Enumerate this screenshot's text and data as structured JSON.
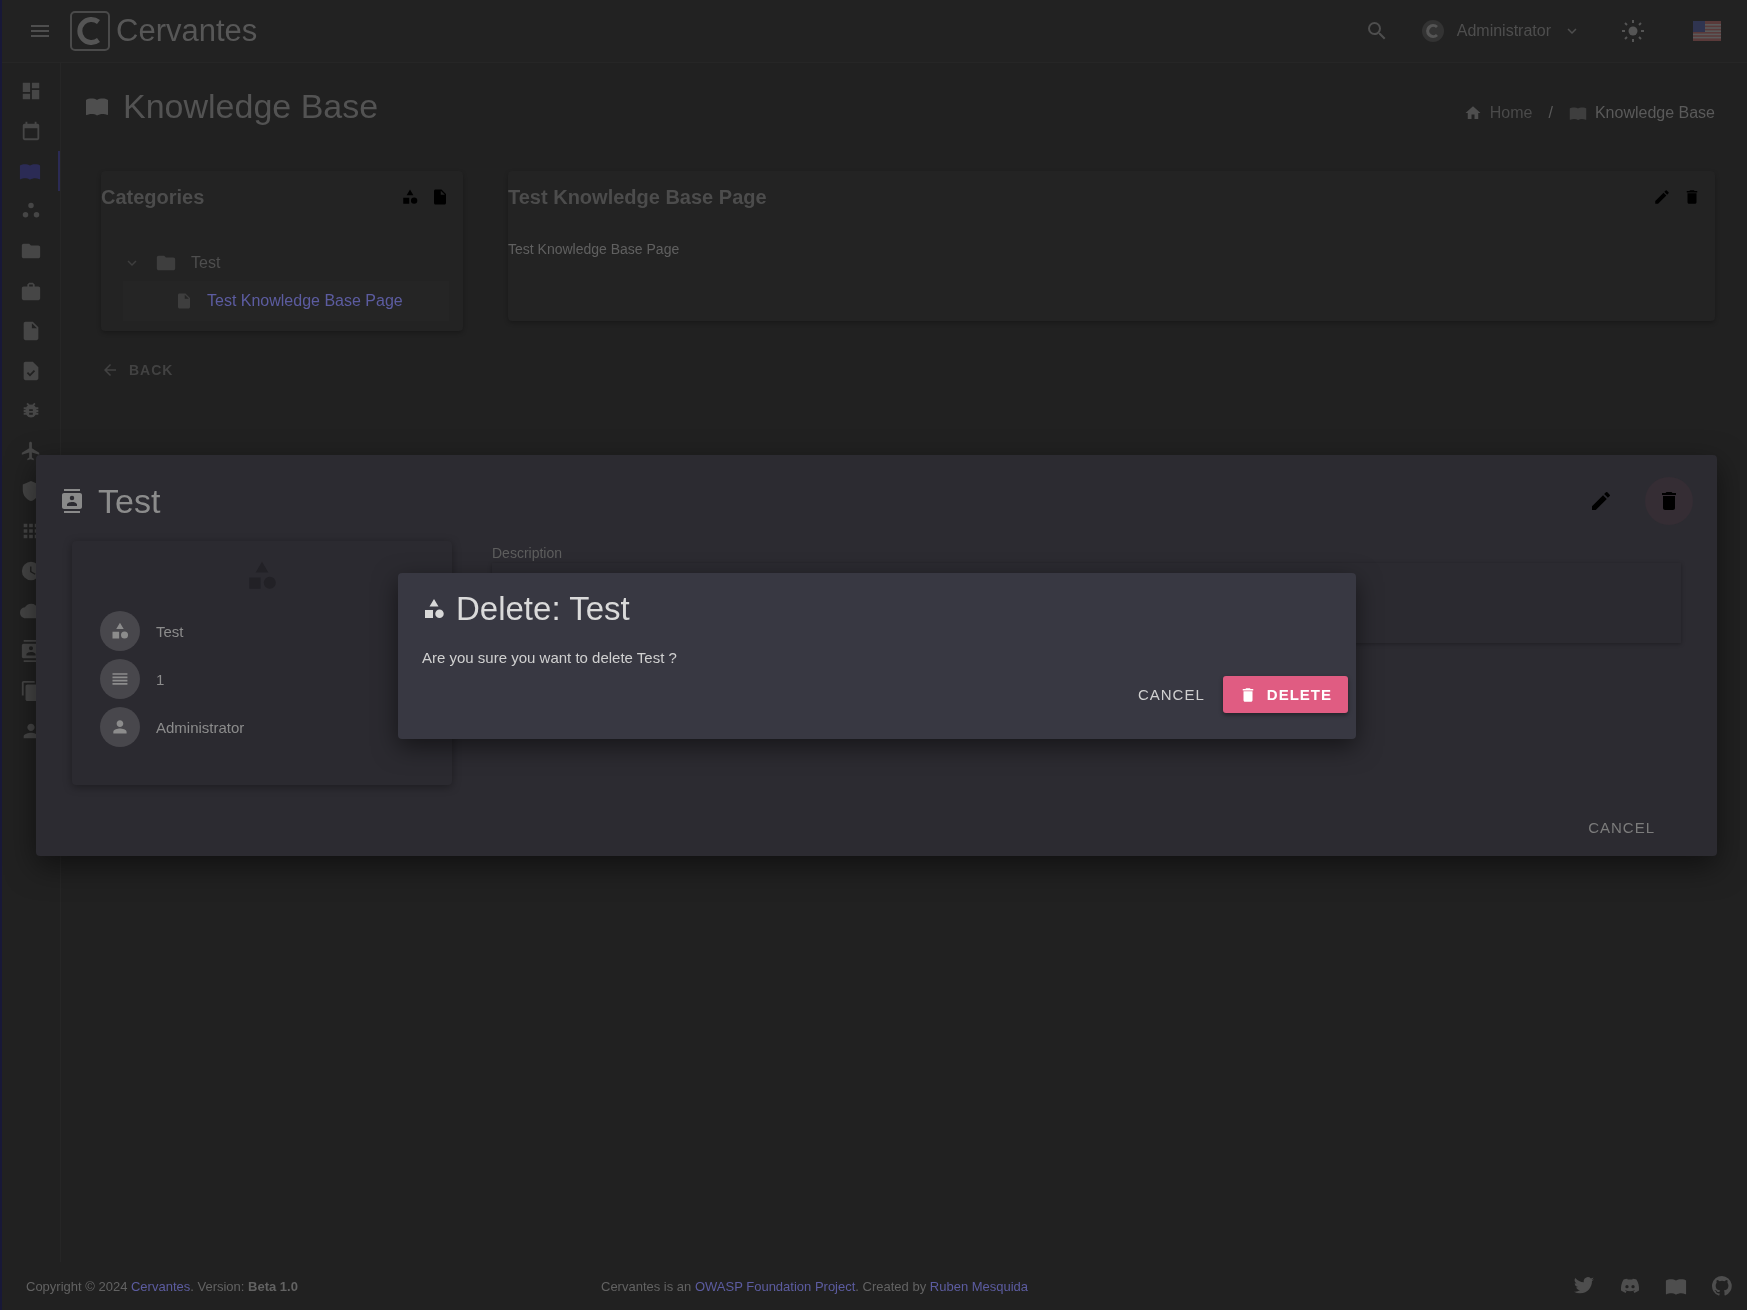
{
  "app": {
    "name": "Cervantes"
  },
  "top_bar": {
    "user": "Administrator"
  },
  "sidebar": {
    "items": [
      {
        "kind": "dashboard",
        "selected": false
      },
      {
        "kind": "calendar",
        "selected": false
      },
      {
        "kind": "book",
        "selected": true
      },
      {
        "kind": "clients",
        "selected": false
      },
      {
        "kind": "folder",
        "selected": false
      },
      {
        "kind": "briefcase",
        "selected": false
      },
      {
        "kind": "document",
        "selected": false
      },
      {
        "kind": "checklist",
        "selected": false
      },
      {
        "kind": "bug",
        "selected": false
      },
      {
        "kind": "plane",
        "selected": false
      },
      {
        "kind": "shield",
        "selected": false
      },
      {
        "kind": "apps",
        "selected": false
      },
      {
        "kind": "clock",
        "selected": false
      },
      {
        "kind": "cloud",
        "selected": false
      },
      {
        "kind": "contact",
        "selected": false
      },
      {
        "kind": "copy",
        "selected": false
      },
      {
        "kind": "person",
        "selected": false
      }
    ]
  },
  "page": {
    "title": "Knowledge Base",
    "breadcrumb": [
      "Home",
      "Knowledge Base"
    ],
    "breadcrumb_separator": "/"
  },
  "categories": {
    "title": "Categories",
    "tree": [
      {
        "label": "Test",
        "expanded": true,
        "children": [
          {
            "label": "Test Knowledge Base Page",
            "selected": true
          }
        ]
      }
    ],
    "back": "BACK"
  },
  "article": {
    "title": "Test Knowledge Base Page",
    "body": "Test Knowledge Base Page"
  },
  "category_dialog": {
    "title": "Test",
    "details": [
      {
        "kind": "shapes",
        "text": "Test"
      },
      {
        "kind": "list",
        "text": "1"
      },
      {
        "kind": "person",
        "text": "Administrator"
      }
    ],
    "description_label": "Description",
    "cancel": "CANCEL"
  },
  "delete_dialog": {
    "title": "Delete: Test",
    "message": "Are you sure you want to delete Test ?",
    "cancel": "CANCEL",
    "confirm": "DELETE"
  },
  "footer": {
    "copyright": {
      "before": "Copyright © 2024 ",
      "link": "Cervantes",
      "after": ". Version: ",
      "version": "Beta 1.0"
    },
    "credits": {
      "before": "Cervantes is an ",
      "link": "OWASP Foundation Project",
      "middle": ". Created by ",
      "author": "Ruben Mesquida"
    }
  }
}
